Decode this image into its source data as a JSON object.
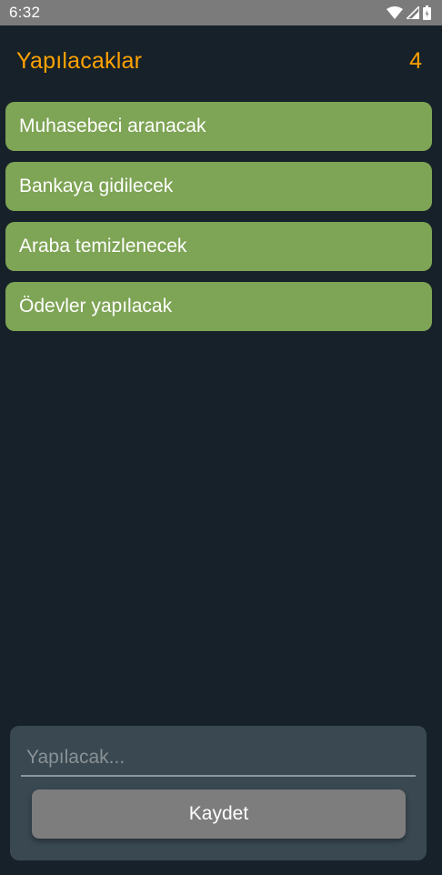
{
  "status_bar": {
    "time": "6:32",
    "icons": [
      "wifi-icon",
      "signal-icon",
      "battery-icon"
    ]
  },
  "header": {
    "title": "Yapılacaklar",
    "count": "4"
  },
  "todos": [
    {
      "label": "Muhasebeci aranacak"
    },
    {
      "label": "Bankaya gidilecek"
    },
    {
      "label": "Araba temizlenecek"
    },
    {
      "label": "Ödevler yapılacak"
    }
  ],
  "form": {
    "input_value": "",
    "input_placeholder": "Yapılacak...",
    "save_label": "Kaydet"
  },
  "colors": {
    "background": "#16212A",
    "accent": "#FFA200",
    "item_background": "#7EA455",
    "card_background": "#394851",
    "button_background": "#7D7D7D",
    "status_bar": "#7B7B7B"
  }
}
